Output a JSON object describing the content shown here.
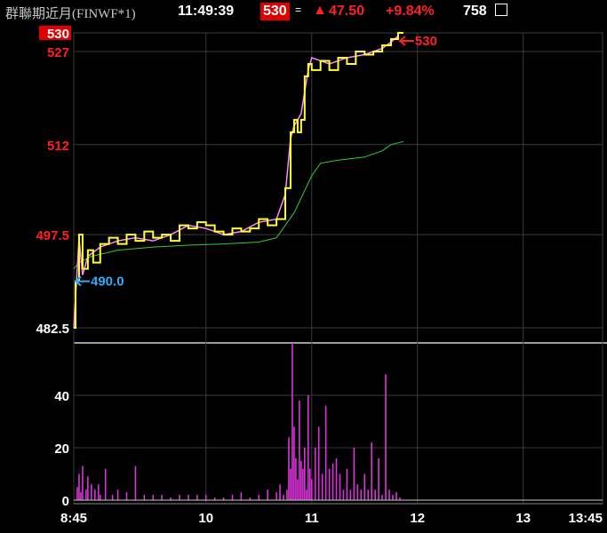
{
  "header": {
    "title": "群聯期近月(FINWF*1)",
    "time": "11:49:39",
    "price": "530",
    "eq_symbol": "=",
    "up_symbol": "▲",
    "change": "47.50",
    "change_pct": "+9.84%",
    "volume": "758"
  },
  "colors": {
    "price_line": "#ffff33",
    "avg_line": "#33cc33",
    "sub_line": "#ff88ff",
    "volume_bar": "#dd33dd",
    "up_red": "#ff2020",
    "grid": "#3a3a3a",
    "entry_arrow": "#33aaff"
  },
  "chart_data": [
    {
      "type": "line",
      "x_ticks": [
        "8:45",
        "10",
        "11",
        "12",
        "13",
        "13:45"
      ],
      "y_ticks": [
        {
          "label": "482.5",
          "value": 482.5
        },
        {
          "label": "497.5",
          "value": 497.5
        },
        {
          "label": "512",
          "value": 512
        },
        {
          "label": "527",
          "value": 527
        },
        {
          "label": "530",
          "value": 530
        }
      ],
      "ylim": [
        482.5,
        530
      ],
      "grid": true,
      "reference": 482.5,
      "annotations": [
        {
          "label": "490.0",
          "x": "08:45",
          "y": 490.0,
          "arrow": "left"
        },
        {
          "label": "530",
          "x": "11:49",
          "y": 530,
          "arrow": "left"
        }
      ],
      "series": [
        {
          "role": "price",
          "x": [
            "08:45",
            "08:46",
            "08:48",
            "08:50",
            "08:53",
            "08:56",
            "09:00",
            "09:05",
            "09:10",
            "09:15",
            "09:20",
            "09:25",
            "09:30",
            "09:35",
            "09:40",
            "09:45",
            "09:50",
            "09:55",
            "10:00",
            "10:05",
            "10:10",
            "10:15",
            "10:20",
            "10:25",
            "10:30",
            "10:35",
            "10:40",
            "10:45",
            "10:48",
            "10:50",
            "10:52",
            "10:54",
            "10:56",
            "10:58",
            "11:00",
            "11:05",
            "11:10",
            "11:15",
            "11:20",
            "11:25",
            "11:30",
            "11:35",
            "11:40",
            "11:45",
            "11:49",
            "11:52"
          ],
          "values": [
            482.5,
            490,
            497.5,
            492,
            495,
            493,
            496,
            497,
            496,
            497.5,
            496.5,
            498,
            497,
            497.5,
            496.5,
            499,
            498.5,
            499.5,
            499,
            498,
            497.5,
            498.5,
            498,
            498.5,
            500,
            499,
            500,
            505,
            514,
            516,
            514,
            516,
            523,
            525,
            524,
            525.5,
            524,
            526,
            525,
            527,
            526.5,
            527,
            528,
            529,
            530,
            530
          ]
        },
        {
          "role": "secondary",
          "x": [
            "08:45",
            "08:48",
            "08:50",
            "08:53",
            "09:00",
            "09:10",
            "09:20",
            "09:30",
            "09:40",
            "09:50",
            "10:00",
            "10:10",
            "10:20",
            "10:30",
            "10:40",
            "10:45",
            "10:48",
            "10:50",
            "10:54",
            "10:58",
            "11:00",
            "11:10",
            "11:20",
            "11:30",
            "11:40",
            "11:45",
            "11:49"
          ],
          "values": [
            482.5,
            497,
            491,
            494,
            495.5,
            496.5,
            497,
            496.5,
            497.5,
            499,
            498.5,
            497.5,
            498,
            499.5,
            500,
            504,
            513,
            515,
            517,
            524,
            526,
            525,
            526,
            526.5,
            527.5,
            528.5,
            529.5
          ]
        },
        {
          "role": "average",
          "x": [
            "08:45",
            "08:48",
            "08:55",
            "09:10",
            "09:30",
            "09:50",
            "10:10",
            "10:30",
            "10:40",
            "10:45",
            "10:50",
            "10:55",
            "11:00",
            "11:05",
            "11:15",
            "11:30",
            "11:40",
            "11:45",
            "11:52"
          ],
          "values": [
            492,
            493,
            494,
            495,
            495.5,
            495.8,
            496,
            496.3,
            497,
            499,
            501,
            504,
            507,
            509,
            509.5,
            510,
            511,
            512,
            512.5
          ]
        }
      ]
    },
    {
      "type": "bar",
      "ylim": [
        0,
        60
      ],
      "y_ticks": [
        {
          "label": "0",
          "value": 0
        },
        {
          "label": "20",
          "value": 20
        },
        {
          "label": "40",
          "value": 40
        }
      ],
      "x": [
        "08:47",
        "08:48",
        "08:49",
        "08:50",
        "08:52",
        "08:53",
        "08:55",
        "08:57",
        "08:59",
        "09:00",
        "09:03",
        "09:07",
        "09:10",
        "09:15",
        "09:20",
        "09:25",
        "09:30",
        "09:35",
        "09:40",
        "09:45",
        "09:50",
        "09:55",
        "10:00",
        "10:05",
        "10:10",
        "10:15",
        "10:20",
        "10:25",
        "10:30",
        "10:35",
        "10:40",
        "10:42",
        "10:44",
        "10:46",
        "10:47",
        "10:48",
        "10:49",
        "10:50",
        "10:51",
        "10:52",
        "10:53",
        "10:54",
        "10:55",
        "10:56",
        "10:57",
        "10:58",
        "10:59",
        "11:00",
        "11:02",
        "11:04",
        "11:06",
        "11:08",
        "11:10",
        "11:12",
        "11:14",
        "11:16",
        "11:18",
        "11:20",
        "11:22",
        "11:24",
        "11:26",
        "11:28",
        "11:30",
        "11:32",
        "11:34",
        "11:36",
        "11:38",
        "11:40",
        "11:42",
        "11:44",
        "11:46",
        "11:48",
        "11:50"
      ],
      "values": [
        5,
        10,
        3,
        13,
        4,
        9,
        6,
        4,
        6,
        2,
        12,
        2,
        4,
        3,
        13,
        2,
        2,
        2,
        1,
        2,
        2,
        2,
        2,
        1,
        1,
        2,
        3,
        1,
        2,
        4,
        3,
        6,
        2,
        4,
        24,
        12,
        60,
        28,
        16,
        8,
        38,
        15,
        12,
        20,
        4,
        40,
        12,
        8,
        20,
        28,
        10,
        36,
        12,
        14,
        16,
        10,
        4,
        12,
        4,
        20,
        6,
        4,
        10,
        4,
        22,
        4,
        16,
        2,
        48,
        4,
        2,
        3,
        1
      ]
    }
  ]
}
